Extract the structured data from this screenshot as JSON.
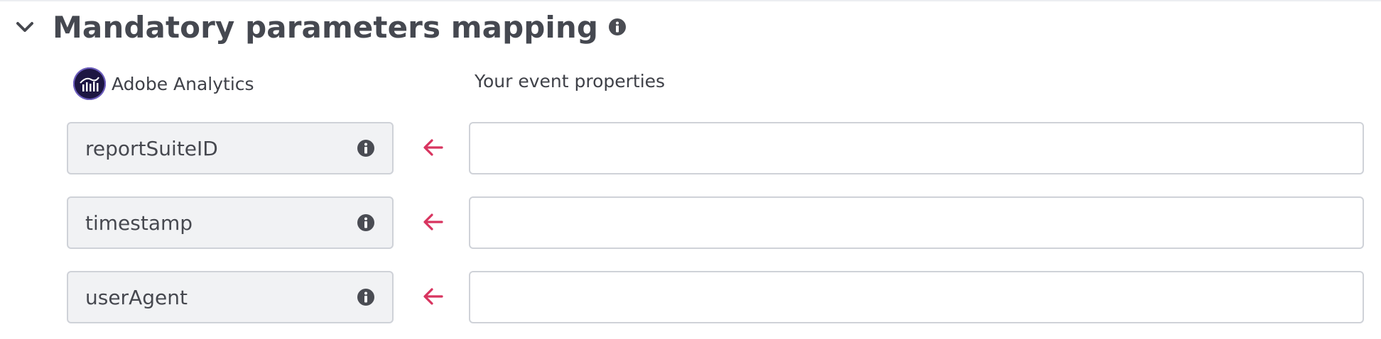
{
  "section": {
    "title": "Mandatory parameters mapping",
    "icons": {
      "toggle": "chevron-down-icon",
      "info": "info-icon"
    }
  },
  "destination": {
    "name": "Adobe Analytics",
    "logo_icon": "adobe-analytics-logo"
  },
  "mapping_column_label": "Your event properties",
  "colors": {
    "arrow": "#d8345f",
    "info_icon": "#4a4c53",
    "field_bg": "#f1f2f4",
    "border": "#cfd2d8",
    "logo_bg": "#1d1642"
  },
  "params": [
    {
      "name": "reportSuiteID",
      "value": "",
      "placeholder": ""
    },
    {
      "name": "timestamp",
      "value": "",
      "placeholder": ""
    },
    {
      "name": "userAgent",
      "value": "",
      "placeholder": ""
    }
  ]
}
